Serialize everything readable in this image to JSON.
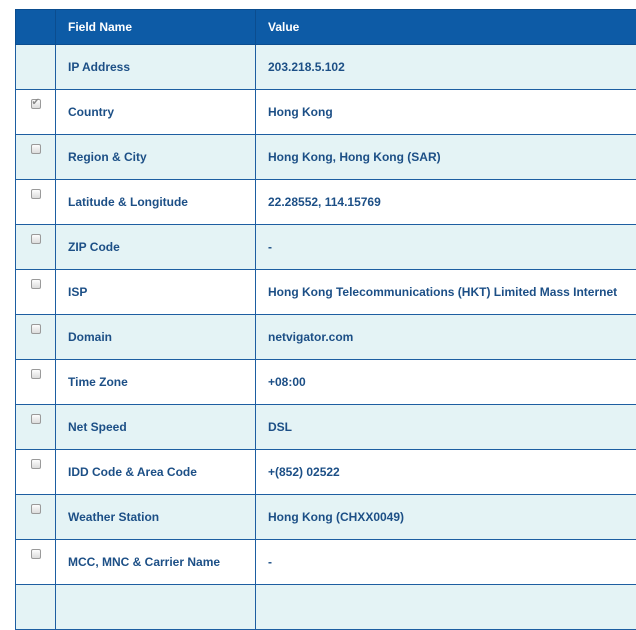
{
  "header": {
    "field_name": "Field Name",
    "value": "Value"
  },
  "rows": [
    {
      "field": "IP Address",
      "value": "203.218.5.102",
      "checkbox": "none"
    },
    {
      "field": "Country",
      "value": "Hong Kong",
      "checkbox": "checked"
    },
    {
      "field": "Region & City",
      "value": "Hong Kong, Hong Kong (SAR)",
      "checkbox": "unchecked"
    },
    {
      "field": "Latitude & Longitude",
      "value": "22.28552, 114.15769",
      "checkbox": "unchecked"
    },
    {
      "field": "ZIP Code",
      "value": "-",
      "checkbox": "unchecked"
    },
    {
      "field": "ISP",
      "value": "Hong Kong Telecommunications (HKT) Limited Mass Internet",
      "checkbox": "unchecked"
    },
    {
      "field": "Domain",
      "value": "netvigator.com",
      "checkbox": "unchecked"
    },
    {
      "field": "Time Zone",
      "value": "+08:00",
      "checkbox": "unchecked"
    },
    {
      "field": "Net Speed",
      "value": "DSL",
      "checkbox": "unchecked"
    },
    {
      "field": "IDD Code & Area Code",
      "value": "+(852) 02522",
      "checkbox": "unchecked"
    },
    {
      "field": "Weather Station",
      "value": "Hong Kong (CHXX0049)",
      "checkbox": "unchecked"
    },
    {
      "field": "MCC, MNC & Carrier Name",
      "value": "-",
      "checkbox": "unchecked"
    },
    {
      "field": "",
      "value": "",
      "checkbox": "none"
    }
  ],
  "colors": {
    "header_bg": "#0d5ba6",
    "alt_row_bg": "#e4f3f5",
    "text": "#1c4f86",
    "border": "#1d5ea1"
  }
}
